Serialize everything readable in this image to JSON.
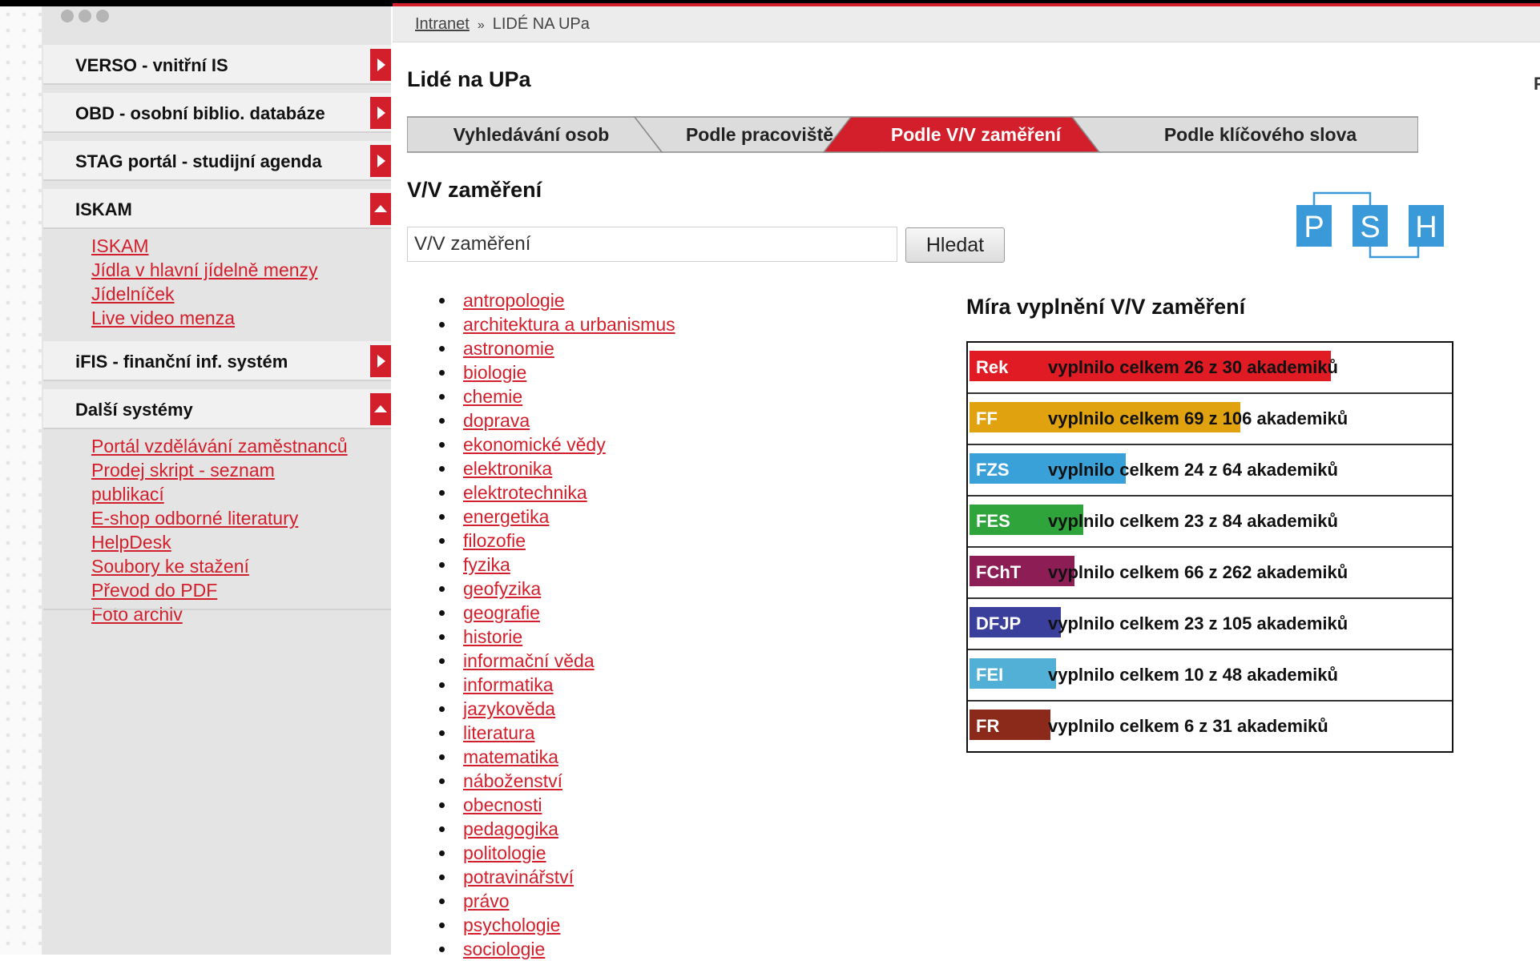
{
  "sidebar": {
    "items": [
      {
        "label": "VERSO - vnitřní IS"
      },
      {
        "label": "OBD - osobní biblio. databáze"
      },
      {
        "label": "STAG portál - studijní agenda"
      },
      {
        "label": "ISKAM"
      },
      {
        "label": "iFIS - finanční inf. systém"
      },
      {
        "label": "Další systémy"
      }
    ],
    "iskam_links": [
      "ISKAM",
      "Jídla v hlavní jídelně menzy",
      "Jídelníček",
      "Live video menza"
    ],
    "dalsi_links": [
      "Portál vzdělávání zaměstnanců",
      "Prodej skript - seznam",
      "publikací",
      "E-shop odborné literatury",
      "HelpDesk",
      "Soubory ke stažení",
      "Převod do PDF",
      "Foto archiv"
    ]
  },
  "breadcrumb": {
    "home": "Intranet",
    "sep": "»",
    "current": "LIDÉ NA UPa"
  },
  "page_title": "Lidé na UPa",
  "edge_letter": "F",
  "tabs": [
    {
      "label": "Vyhledávání osob"
    },
    {
      "label": "Podle pracoviště"
    },
    {
      "label": "Podle V/V zaměření"
    },
    {
      "label": "Podle klíčového slova"
    }
  ],
  "section_title": "V/V zaměření",
  "search": {
    "value": "V/V zaměření",
    "button": "Hledat"
  },
  "topics": [
    "antropologie",
    "architektura a urbanismus",
    "astronomie",
    "biologie",
    "chemie",
    "doprava",
    "ekonomické vědy",
    "elektronika",
    "elektrotechnika",
    "energetika",
    "filozofie",
    "fyzika",
    "geofyzika",
    "geografie",
    "historie",
    "informační věda",
    "informatika",
    "jazykověda",
    "literatura",
    "matematika",
    "náboženství",
    "obecnosti",
    "pedagogika",
    "politologie",
    "potravinářství",
    "právo",
    "psychologie",
    "sociologie"
  ],
  "logo": {
    "letters": [
      "P",
      "S",
      "H"
    ],
    "color": "#3a9ad9"
  },
  "stats": {
    "title": "Míra vyplnění V/V zaměření",
    "rows": [
      {
        "faculty": "Rek",
        "text": "vyplnilo celkem 26 z 30 akademiků",
        "filled": 26,
        "total": 30,
        "color": "#e01b24"
      },
      {
        "faculty": "FF",
        "text": "vyplnilo celkem 69 z 106 akademiků",
        "filled": 69,
        "total": 106,
        "color": "#e0a20f"
      },
      {
        "faculty": "FZS",
        "text": "vyplnilo celkem 24 z 64 akademiků",
        "filled": 24,
        "total": 64,
        "color": "#3aa0d8"
      },
      {
        "faculty": "FES",
        "text": "vyplnilo celkem 23 z 84 akademiků",
        "filled": 23,
        "total": 84,
        "color": "#2ea43a"
      },
      {
        "faculty": "FChT",
        "text": "vyplnilo celkem 66 z 262 akademiků",
        "filled": 66,
        "total": 262,
        "color": "#8c1d55"
      },
      {
        "faculty": "DFJP",
        "text": "vyplnilo celkem 23 z 105 akademiků",
        "filled": 23,
        "total": 105,
        "color": "#3a3f9c"
      },
      {
        "faculty": "FEI",
        "text": "vyplnilo celkem 10 z 48 akademiků",
        "filled": 10,
        "total": 48,
        "color": "#52b0d6"
      },
      {
        "faculty": "FR",
        "text": "vyplnilo celkem 6 z 31 akademiků",
        "filled": 6,
        "total": 31,
        "color": "#8b2a1a"
      }
    ]
  }
}
